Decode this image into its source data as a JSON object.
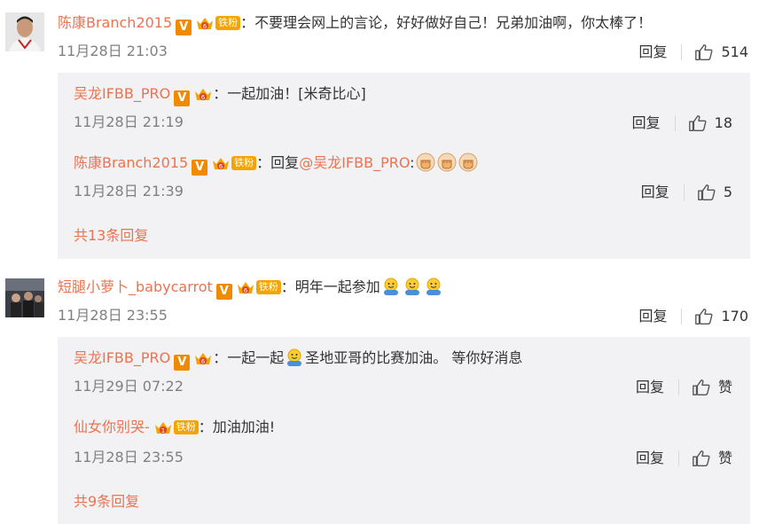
{
  "comments": [
    {
      "author": "陈康Branch2015",
      "text": "：不要理会网上的言论，好好做好自己！兄弟加油啊，你太棒了！",
      "time": "11月28日 21:03",
      "reply_label": "回复",
      "likes": "514",
      "badge_level": "6",
      "fan_badge": "铁粉",
      "replies": [
        {
          "author": "吴龙IFBB_PRO",
          "text": "：一起加油！[米奇比心]",
          "time": "11月28日 21:19",
          "reply_label": "回复",
          "likes": "18",
          "badge_level": "6"
        },
        {
          "author": "陈康Branch2015",
          "text_prefix": "：回复",
          "mention": "@吴龙IFBB_PRO",
          "text_suffix": ":",
          "time": "11月28日 21:39",
          "reply_label": "回复",
          "likes": "5",
          "badge_level": "6",
          "fan_badge": "铁粉"
        }
      ],
      "more_label": "共13条回复"
    },
    {
      "author": "短腿小萝卜_babycarrot",
      "text": "：明年一起参加",
      "time": "11月28日 23:55",
      "reply_label": "回复",
      "likes": "170",
      "badge_level": "6",
      "fan_badge": "铁粉",
      "replies": [
        {
          "author": "吴龙IFBB_PRO",
          "text_a": "：一起一起",
          "text_b": "圣地亚哥的比赛加油。 等你好消息",
          "time": "11月29日 07:22",
          "reply_label": "回复",
          "likes": "赞",
          "badge_level": "6"
        },
        {
          "author": "仙女你别哭-",
          "text": "：加油加油!",
          "time": "11月28日 23:55",
          "reply_label": "回复",
          "likes": "赞",
          "badge_level": "1",
          "fan_badge": "铁粉"
        }
      ],
      "more_label": "共9条回复"
    }
  ],
  "colors": {
    "accent": "#eb7350",
    "meta": "#808080",
    "reply_bg": "#f2f2f5",
    "vip": "#f08a00"
  },
  "icons": [
    "thumbs-up-icon",
    "v-verified-icon",
    "crown-level-icon",
    "fist-emoji-icon",
    "happy-face-emoji-icon"
  ]
}
